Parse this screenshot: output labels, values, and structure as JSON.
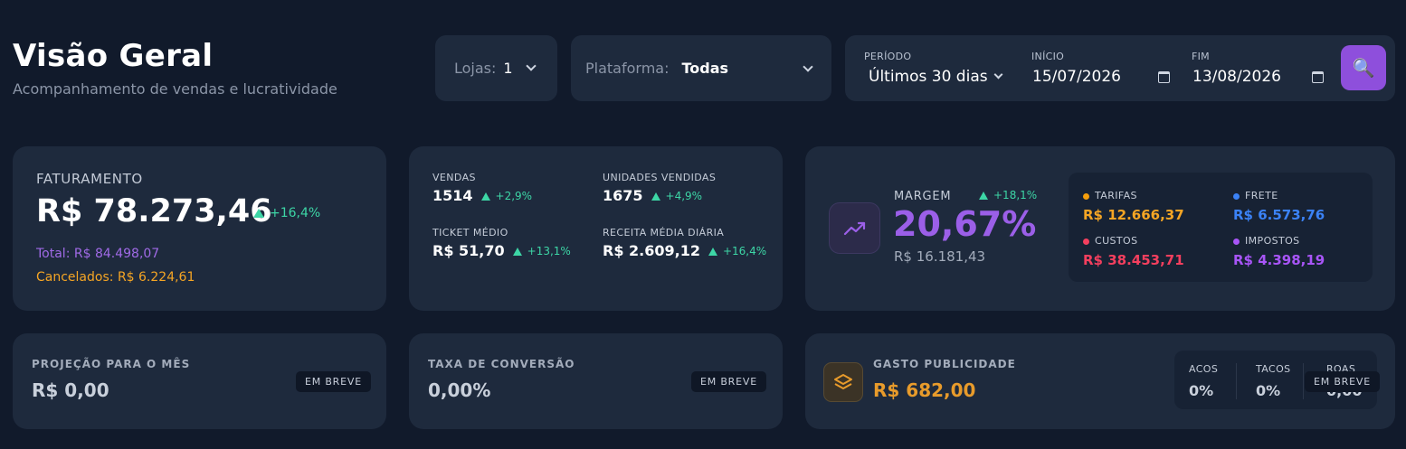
{
  "header": {
    "title": "Visão Geral",
    "subtitle": "Acompanhamento de vendas e lucratividade"
  },
  "filters": {
    "lojas_label": "Lojas:",
    "lojas_value": "1",
    "plataforma_label": "Plataforma:",
    "plataforma_value": "Todas",
    "periodo_label": "PERÍODO",
    "periodo_value": "Últimos 30 dias",
    "inicio_label": "INÍCIO",
    "inicio_value": "15/07/2026",
    "fim_label": "FIM",
    "fim_value": "13/08/2026",
    "search_icon": "🔍"
  },
  "faturamento": {
    "label": "FATURAMENTO",
    "value": "R$ 78.273,46",
    "change": "+16,4%",
    "total_label": "Total:",
    "total_value": "R$ 84.498,07",
    "cancel_label": "Cancelados:",
    "cancel_value": "R$ 6.224,61"
  },
  "vendas": {
    "vendas_label": "VENDAS",
    "vendas_value": "1514",
    "vendas_change": "+2,9%",
    "unidades_label": "UNIDADES VENDIDAS",
    "unidades_value": "1675",
    "unidades_change": "+4,9%",
    "ticket_label": "TICKET MÉDIO",
    "ticket_value": "R$ 51,70",
    "ticket_change": "+13,1%",
    "receita_label": "RECEITA MÉDIA DIÁRIA",
    "receita_value": "R$ 2.609,12",
    "receita_change": "+16,4%"
  },
  "margem": {
    "label": "MARGEM",
    "change": "+18,1%",
    "value": "20,67%",
    "sub": "R$ 16.181,43",
    "tarifas_label": "TARIFAS",
    "tarifas_value": "R$ 12.666,37",
    "frete_label": "FRETE",
    "frete_value": "R$ 6.573,76",
    "custos_label": "CUSTOS",
    "custos_value": "R$ 38.453,71",
    "impostos_label": "IMPOSTOS",
    "impostos_value": "R$ 4.398,19"
  },
  "projecao": {
    "label": "PROJEÇÃO PARA O MÊS",
    "value": "R$ 0,00",
    "badge": "EM BREVE"
  },
  "conversao": {
    "label": "TAXA DE CONVERSÃO",
    "value": "0,00%",
    "badge": "EM BREVE"
  },
  "publicidade": {
    "label": "GASTO PUBLICIDADE",
    "value": "R$ 682,00",
    "acos_label": "ACOS",
    "acos_value": "0%",
    "tacos_label": "TACOS",
    "tacos_value": "0%",
    "roas_label": "ROAS",
    "roas_value": "0,00",
    "badge": "EM BREVE"
  },
  "colors": {
    "accent": "#8e4fdc",
    "positive": "#3dd6a6",
    "orange": "#f59e0b",
    "blue": "#3b82f6",
    "red": "#f43f5e",
    "purple": "#a855f7"
  }
}
